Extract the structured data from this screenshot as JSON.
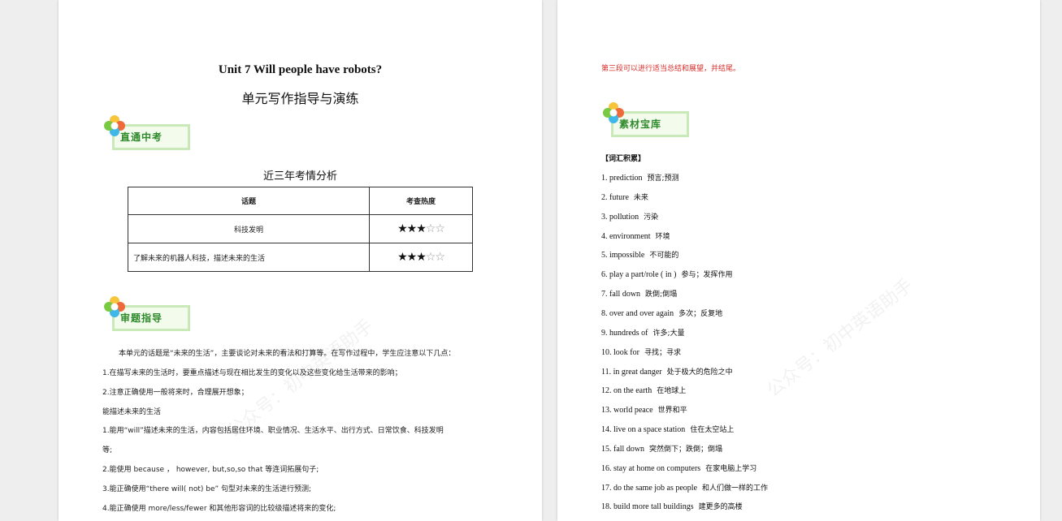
{
  "left_page": {
    "title_en": "Unit 7 Will people have robots?",
    "title_zh": "单元写作指导与演练",
    "banner1": "直通中考",
    "table_caption": "近三年考情分析",
    "table": {
      "headers": [
        "话题",
        "考查热度"
      ],
      "rows": [
        {
          "topic": "科技发明",
          "stars_on": "★★★",
          "stars_off": "☆☆",
          "rating": 3
        },
        {
          "topic": "了解未来的机器人科技，描述未来的生活",
          "stars_on": "★★★",
          "stars_off": "☆☆",
          "rating": 3
        }
      ]
    },
    "banner2": "审题指导",
    "lines": [
      "本单元的话题是“未来的生活”，主要谈论对未来的看法和打算等。在写作过程中，学生应注意以下几点：",
      "1.在描写未来的生活时，要重点描述与现在相比发生的变化以及这些变化给生活带来的影响；",
      "2.注意正确使用一般将来时，合理展开想象；",
      "能描述未来的生活",
      "1.能用“will”描述未来的生活，内容包括居住环境、职业情况、生活水平、出行方式、日常饮食、科技发明",
      "等;",
      "2.能使用 because ， however, but,so,so that  等连词拓展句子;",
      "3.能正确使用“there will( not) be”  句型对未来的生活进行预测;",
      "4.能正确使用 more/less/fewer 和其他形容词的比较级描述将来的变化;"
    ]
  },
  "right_page": {
    "note": "第三段可以进行适当总结和展望，并结尾。",
    "banner": "素材宝库",
    "vocab_heading": "【词汇积累】",
    "vocab": [
      {
        "en": "1. prediction",
        "zh": "预言;预测"
      },
      {
        "en": "2. future",
        "zh": "未来"
      },
      {
        "en": "3. pollution",
        "zh": "污染"
      },
      {
        "en": "4. environment",
        "zh": "环境"
      },
      {
        "en": "5. impossible",
        "zh": "不可能的"
      },
      {
        "en": "6. play a part/role (     in     )",
        "zh": "参与；发挥作用"
      },
      {
        "en": "7. fall down",
        "zh": "跌倒;倒塌"
      },
      {
        "en": "8. over and over again",
        "zh": "多次；反复地"
      },
      {
        "en": "9. hundreds of",
        "zh": "许多;大量"
      },
      {
        "en": "10. look for",
        "zh": "寻找；寻求"
      },
      {
        "en": "11. in great danger",
        "zh": "处于极大的危险之中"
      },
      {
        "en": "12. on the earth",
        "zh": "在地球上"
      },
      {
        "en": "13. world peace",
        "zh": "世界和平"
      },
      {
        "en": "14. live on a space station",
        "zh": "住在太空站上"
      },
      {
        "en": "15. fall down",
        "zh": "突然倒下；跌倒；倒塌"
      },
      {
        "en": "16. stay at home on computers",
        "zh": "在家电脑上学习"
      },
      {
        "en": "17. do the same job as people",
        "zh": "和人们做一样的工作"
      },
      {
        "en": "18. build more tall buildings",
        "zh": "建更多的高楼"
      }
    ]
  },
  "watermark": "公众号：初中英语助手",
  "colors": {
    "note_red": "#d9302c",
    "banner_green": "#2f8a2c"
  }
}
